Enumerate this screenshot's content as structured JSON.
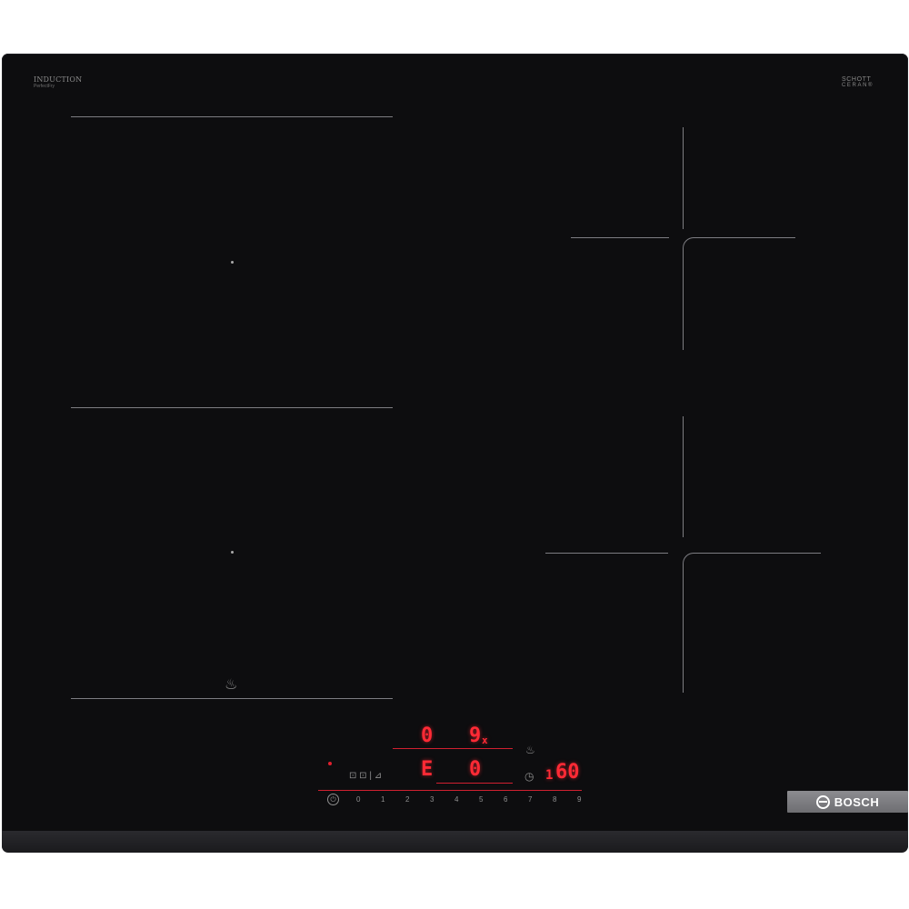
{
  "branding": {
    "top_left_title": "INDUCTION",
    "top_left_sub": "PerfectFry",
    "top_right_line1": "SCHOTT",
    "top_right_line2": "CERAN®",
    "top_right_line3": "",
    "brand_name": "BOSCH"
  },
  "zones": [
    {
      "name": "left-front-flex-zone"
    },
    {
      "name": "left-rear-flex-zone"
    },
    {
      "name": "right-rear-zone"
    },
    {
      "name": "right-front-zone"
    }
  ],
  "panel": {
    "zone_display_rear_left": "0",
    "zone_display_rear_right": "9",
    "zone_display_rear_right_suffix": "x",
    "zone_display_front_left": "E",
    "zone_display_front_right": "0",
    "timer_display": "60",
    "timer_prefix": "1",
    "function_labels": "⊡ ⊡ | ⊿",
    "slider_values": [
      "0",
      "1",
      "2",
      "3",
      "4",
      "5",
      "6",
      "7",
      "8",
      "9"
    ],
    "accent_color": "#ff2a35"
  },
  "icons": {
    "power": "power-icon",
    "flex": "flex-induction-icon",
    "timer": "clock-icon",
    "perfectfry": "frying-pan-sensor-icon"
  }
}
